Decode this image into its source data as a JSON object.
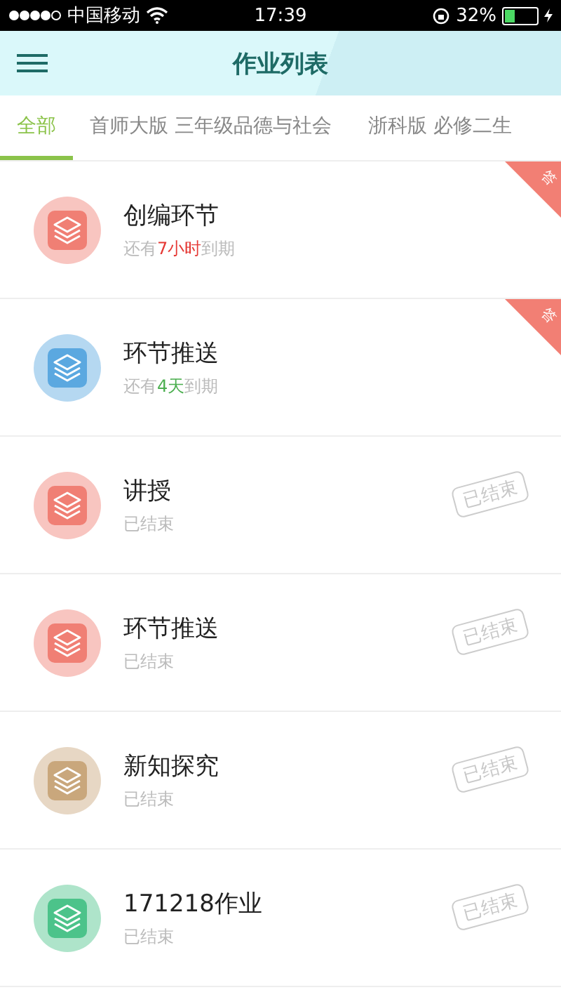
{
  "status_bar": {
    "carrier": "中国移动",
    "time": "17:39",
    "battery": "32%"
  },
  "header": {
    "title": "作业列表"
  },
  "tabs": [
    {
      "label": "全部",
      "selected": true
    },
    {
      "label": "首师大版 三年级品德与社会",
      "selected": false
    },
    {
      "label": "浙科版 必修二生",
      "selected": false
    }
  ],
  "assignments": [
    {
      "title": "创编环节",
      "color": "#f07f74",
      "kind": "due",
      "status": {
        "prefix": "还有",
        "highlight": "7小时",
        "suffix": "到期",
        "color": "#e53935"
      },
      "ribbon": "答"
    },
    {
      "title": "环节推送",
      "color": "#5ba8e0",
      "kind": "due",
      "status": {
        "prefix": "还有",
        "highlight": "4天",
        "suffix": "到期",
        "color": "#4caf50"
      },
      "ribbon": "答"
    },
    {
      "title": "讲授",
      "color": "#f07f74",
      "kind": "ended",
      "status": {
        "text": "已结束"
      },
      "stamp": "已结束"
    },
    {
      "title": "环节推送",
      "color": "#f07f74",
      "kind": "ended",
      "status": {
        "text": "已结束"
      },
      "stamp": "已结束"
    },
    {
      "title": "新知探究",
      "color": "#c9a77c",
      "kind": "ended",
      "status": {
        "text": "已结束"
      },
      "stamp": "已结束"
    },
    {
      "title": "171218作业",
      "color": "#4cc38a",
      "kind": "ended",
      "status": {
        "text": "已结束"
      },
      "stamp": "已结束"
    }
  ]
}
